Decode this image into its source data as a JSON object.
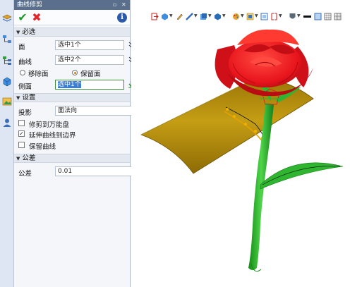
{
  "dialog": {
    "title": "曲线修剪",
    "pin_glyph": "▫",
    "close_glyph": "✕",
    "ok_glyph": "✔",
    "cancel_glyph": "✖",
    "info_glyph": "i"
  },
  "sections": {
    "required": "必选",
    "settings": "设置",
    "tolerance": "公差"
  },
  "required": {
    "face_label": "面",
    "face_value": "选中1个",
    "curve_label": "曲线",
    "curve_value": "选中2个",
    "remove_face_label": "移除面",
    "keep_face_label": "保留面",
    "side_label": "侧面",
    "side_value": "选中1个"
  },
  "settings": {
    "projection_label": "投影",
    "projection_value": "面法向",
    "trim_to_universal": "修剪到万能盘",
    "extend_to_boundary": "延伸曲线到边界",
    "keep_curve": "保留曲线",
    "extend_checked": true
  },
  "tolerance": {
    "label": "公差",
    "value": "0.01"
  },
  "colors": {
    "petal": "#e8141c",
    "stem": "#2fb52f",
    "surface": "#b8910e",
    "accent": "#2c5aa8"
  }
}
